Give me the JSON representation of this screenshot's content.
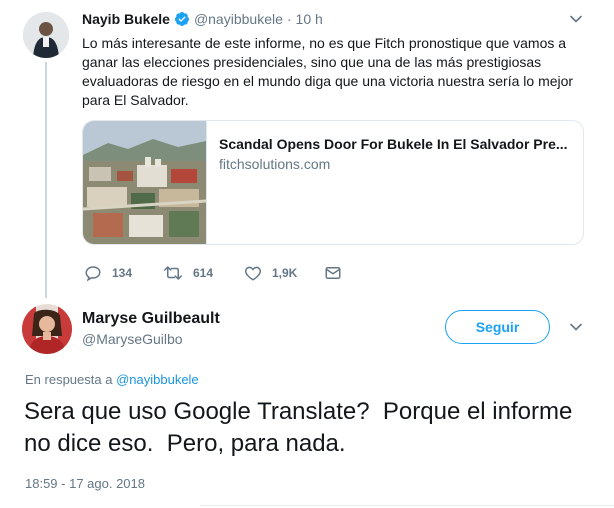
{
  "parent_tweet": {
    "name": "Nayib Bukele",
    "handle": "@nayibbukele",
    "separator": "·",
    "time": "10 h",
    "text": "Lo más interesante de este informe, no es que Fitch pronostique que vamos a ganar las elecciones presidenciales, sino que una de las más prestigiosas evaluadoras de riesgo en el mundo diga que una victoria nuestra sería lo mejor para El Salvador.",
    "card": {
      "title": "Scandal Opens Door For Bukele In El Salvador Pre...",
      "domain": "fitchsolutions.com"
    },
    "actions": {
      "replies": "134",
      "retweets": "614",
      "likes": "1,9K"
    }
  },
  "main_tweet": {
    "name": "Maryse Guilbeault",
    "handle": "@MaryseGuilbo",
    "follow_label": "Seguir",
    "reply_prefix": "En respuesta a",
    "reply_to": "@nayibbukele",
    "text": "Sera que uso Google Translate?  Porque el informe no dice eso.  Pero, para nada.",
    "timestamp": "18:59 - 17 ago. 2018"
  },
  "colors": {
    "accent": "#1da1f2",
    "verified": "#1da1f2",
    "muted": "#657786",
    "link": "#1b95e0"
  }
}
